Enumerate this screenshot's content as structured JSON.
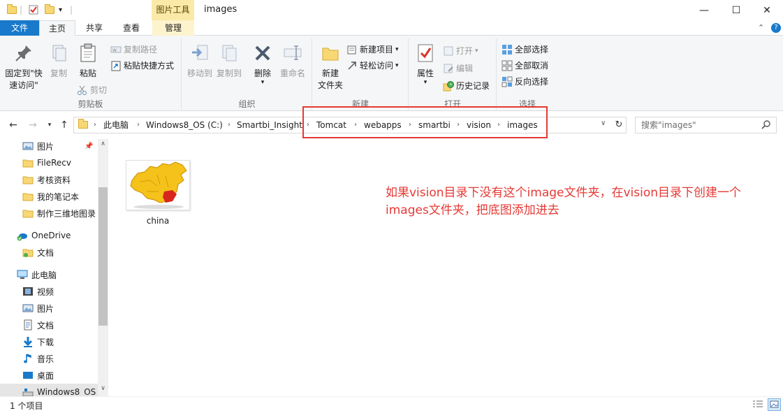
{
  "titlebar": {
    "context_tab": "图片工具",
    "title": "images",
    "minimize": "—",
    "maximize": "☐",
    "close": "✕"
  },
  "tabs": {
    "file": "文件",
    "home": "主页",
    "share": "共享",
    "view": "查看",
    "manage": "管理"
  },
  "ribbon": {
    "clipboard": {
      "label": "剪贴板",
      "pin_line1": "固定到\"快",
      "pin_line2": "速访问\"",
      "copy": "复制",
      "paste": "粘贴",
      "copy_path": "复制路径",
      "paste_shortcut": "粘贴快捷方式",
      "cut": "剪切"
    },
    "organize": {
      "label": "组织",
      "move_to": "移动到",
      "copy_to": "复制到",
      "delete": "删除",
      "rename": "重命名"
    },
    "new": {
      "label": "新建",
      "new_folder_line1": "新建",
      "new_folder_line2": "文件夹",
      "new_item": "新建项目",
      "easy_access": "轻松访问"
    },
    "open": {
      "label": "打开",
      "properties": "属性",
      "open": "打开",
      "edit": "编辑",
      "history": "历史记录"
    },
    "select": {
      "label": "选择",
      "select_all": "全部选择",
      "select_none": "全部取消",
      "invert": "反向选择"
    }
  },
  "address": {
    "crumbs": [
      "此电脑",
      "Windows8_OS (C:)",
      "Smartbi_Insight",
      "Tomcat",
      "webapps",
      "smartbi",
      "vision",
      "images"
    ],
    "search_placeholder": "搜索\"images\""
  },
  "sidebar": {
    "items": [
      {
        "label": "图片",
        "icon": "pictures-icon"
      },
      {
        "label": "FileRecv",
        "icon": "folder-icon"
      },
      {
        "label": "考核资料",
        "icon": "folder-icon"
      },
      {
        "label": "我的笔记本",
        "icon": "folder-icon"
      },
      {
        "label": "制作三维地图录",
        "icon": "folder-icon"
      },
      {
        "label": "OneDrive",
        "icon": "onedrive-icon"
      },
      {
        "label": "文档",
        "icon": "documents-icon"
      },
      {
        "label": "此电脑",
        "icon": "this-pc-icon"
      },
      {
        "label": "视频",
        "icon": "videos-icon"
      },
      {
        "label": "图片",
        "icon": "pictures-icon"
      },
      {
        "label": "文档",
        "icon": "documents-icon"
      },
      {
        "label": "下载",
        "icon": "downloads-icon"
      },
      {
        "label": "音乐",
        "icon": "music-icon"
      },
      {
        "label": "桌面",
        "icon": "desktop-icon"
      },
      {
        "label": "Windows8_OS",
        "icon": "drive-icon"
      }
    ]
  },
  "content": {
    "files": [
      {
        "name": "china"
      }
    ],
    "annotation_line1": "如果vision目录下没有这个image文件夹，在vision目录下创建一个",
    "annotation_line2": "images文件夹，把底图添加进去"
  },
  "status": {
    "count": "1 个项目"
  },
  "colors": {
    "accent": "#1979ca",
    "highlight": "#e53935",
    "context_tab": "#fbe9a8"
  }
}
